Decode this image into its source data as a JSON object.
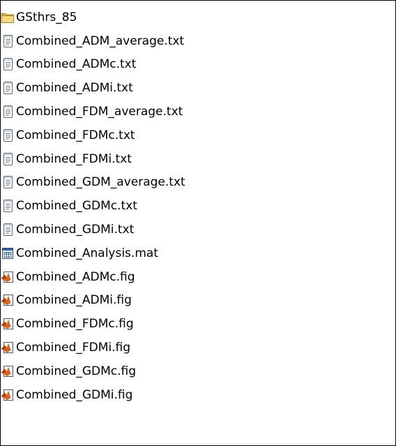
{
  "files": [
    {
      "name": "GSthrs_85",
      "icon": "folder-icon"
    },
    {
      "name": "Combined_ADM_average.txt",
      "icon": "text-document-icon"
    },
    {
      "name": "Combined_ADMc.txt",
      "icon": "text-document-icon"
    },
    {
      "name": "Combined_ADMi.txt",
      "icon": "text-document-icon"
    },
    {
      "name": "Combined_FDM_average.txt",
      "icon": "text-document-icon"
    },
    {
      "name": "Combined_FDMc.txt",
      "icon": "text-document-icon"
    },
    {
      "name": "Combined_FDMi.txt",
      "icon": "text-document-icon"
    },
    {
      "name": "Combined_GDM_average.txt",
      "icon": "text-document-icon"
    },
    {
      "name": "Combined_GDMc.txt",
      "icon": "text-document-icon"
    },
    {
      "name": "Combined_GDMi.txt",
      "icon": "text-document-icon"
    },
    {
      "name": "Combined_Analysis.mat",
      "icon": "mat-file-icon"
    },
    {
      "name": "Combined_ADMc.fig",
      "icon": "matlab-figure-icon"
    },
    {
      "name": "Combined_ADMi.fig",
      "icon": "matlab-figure-icon"
    },
    {
      "name": "Combined_FDMc.fig",
      "icon": "matlab-figure-icon"
    },
    {
      "name": "Combined_FDMi.fig",
      "icon": "matlab-figure-icon"
    },
    {
      "name": "Combined_GDMc.fig",
      "icon": "matlab-figure-icon"
    },
    {
      "name": "Combined_GDMi.fig",
      "icon": "matlab-figure-icon"
    }
  ]
}
